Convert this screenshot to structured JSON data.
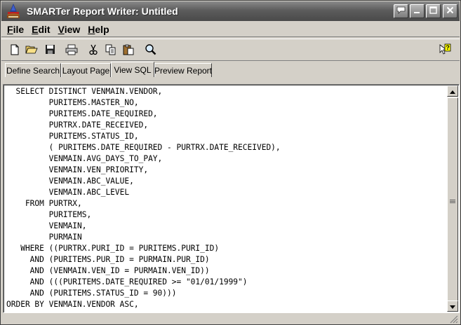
{
  "window": {
    "title": "SMARTer Report Writer: Untitled"
  },
  "menu": {
    "items": [
      {
        "label": "File",
        "accel": "F",
        "rest": "ile"
      },
      {
        "label": "Edit",
        "accel": "E",
        "rest": "dit"
      },
      {
        "label": "View",
        "accel": "V",
        "rest": "iew"
      },
      {
        "label": "Help",
        "accel": "H",
        "rest": "elp"
      }
    ]
  },
  "toolbar": {
    "icons": [
      "new-document-icon",
      "open-folder-icon",
      "save-disk-icon",
      "print-icon",
      "cut-icon",
      "copy-icon",
      "paste-icon",
      "zoom-search-icon",
      "context-help-icon"
    ]
  },
  "tabs": [
    {
      "label": "Define Search",
      "active": false
    },
    {
      "label": "Layout Page",
      "active": false
    },
    {
      "label": "View SQL",
      "active": true
    },
    {
      "label": "Preview Report",
      "active": false
    }
  ],
  "sql": {
    "lines": [
      "  SELECT DISTINCT VENMAIN.VENDOR,",
      "         PURITEMS.MASTER_NO,",
      "         PURITEMS.DATE_REQUIRED,",
      "         PURTRX.DATE_RECEIVED,",
      "         PURITEMS.STATUS_ID,",
      "         ( PURITEMS.DATE_REQUIRED - PURTRX.DATE_RECEIVED),",
      "         VENMAIN.AVG_DAYS_TO_PAY,",
      "         VENMAIN.VEN_PRIORITY,",
      "         VENMAIN.ABC_VALUE,",
      "         VENMAIN.ABC_LEVEL",
      "    FROM PURTRX,",
      "         PURITEMS,",
      "         VENMAIN,",
      "         PURMAIN",
      "   WHERE ((PURTRX.PURI_ID = PURITEMS.PURI_ID)",
      "     AND (PURITEMS.PUR_ID = PURMAIN.PUR_ID)",
      "     AND (VENMAIN.VEN_ID = PURMAIN.VEN_ID))",
      "     AND (((PURITEMS.DATE_REQUIRED >= \"01/01/1999\")",
      "     AND (PURITEMS.STATUS_ID = 90)))",
      "ORDER BY VENMAIN.VENDOR ASC,"
    ]
  },
  "colors": {
    "titlebar": "#5c5c5c",
    "face": "#d4d0c8",
    "editor_bg": "#ffffff"
  }
}
